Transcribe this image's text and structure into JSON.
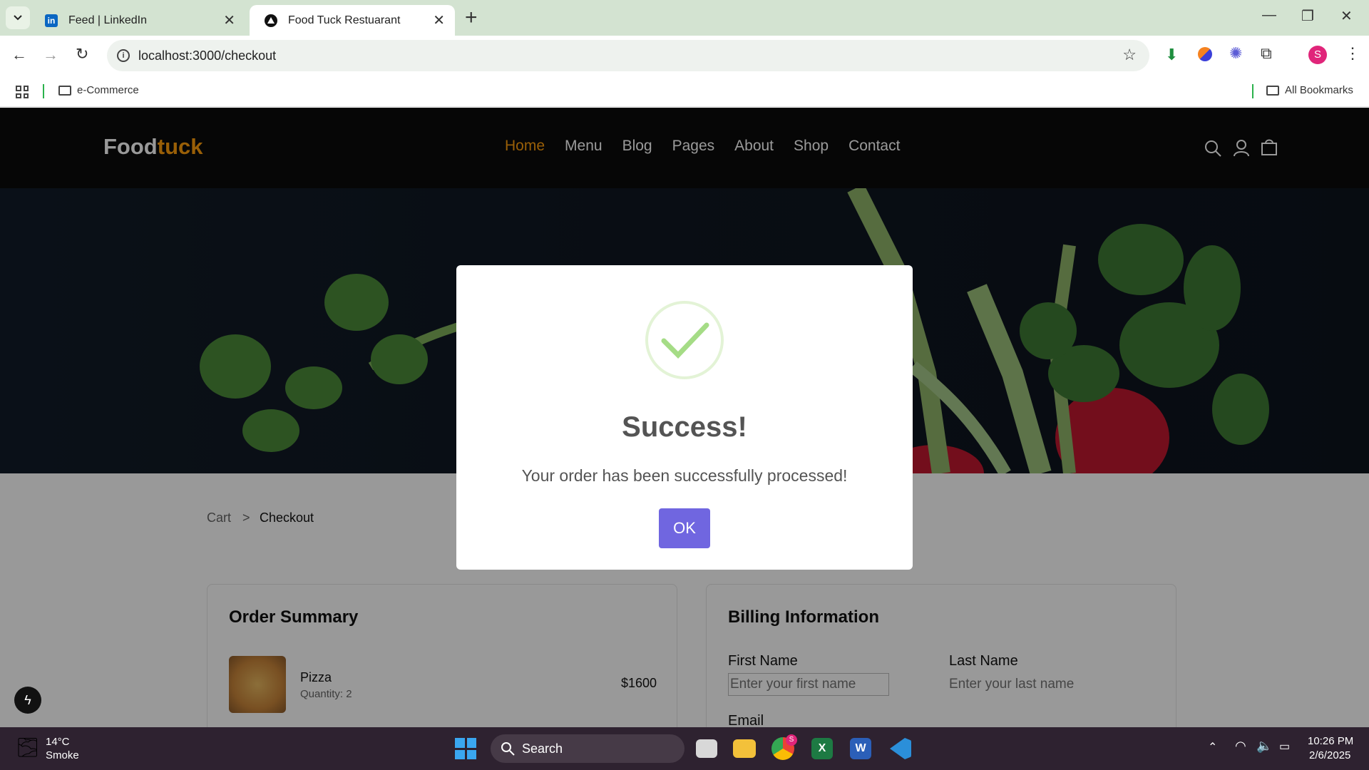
{
  "browser": {
    "tabs": [
      {
        "title": "Feed | LinkedIn",
        "active": false
      },
      {
        "title": "Food Tuck Restuarant",
        "active": true
      }
    ],
    "url": "localhost:3000/checkout",
    "bookmarks": {
      "folder": "e-Commerce",
      "all": "All Bookmarks"
    },
    "profile_initial": "S"
  },
  "site": {
    "logo_main": "Food",
    "logo_accent": "tuck",
    "nav": [
      "Home",
      "Menu",
      "Blog",
      "Pages",
      "About",
      "Shop",
      "Contact"
    ],
    "active_nav": "Home",
    "accent_color": "#ff9f0d"
  },
  "breadcrumb": {
    "cart": "Cart",
    "separator": ">",
    "current": "Checkout"
  },
  "order_summary": {
    "title": "Order Summary",
    "items": [
      {
        "name": "Pizza",
        "quantity": "Quantity: 2",
        "price": "$1600"
      }
    ]
  },
  "billing": {
    "title": "Billing Information",
    "first_name_label": "First Name",
    "first_name_placeholder": "Enter your first name",
    "last_name_label": "Last Name",
    "last_name_placeholder": "Enter your last name",
    "email_label": "Email"
  },
  "modal": {
    "title": "Success!",
    "message": "Your order has been successfully processed!",
    "ok_label": "OK",
    "button_color": "#7066e0"
  },
  "taskbar": {
    "weather_temp": "14°C",
    "weather_desc": "Smoke",
    "search_label": "Search",
    "time": "10:26 PM",
    "date": "2/6/2025",
    "chrome_badge": "S"
  }
}
